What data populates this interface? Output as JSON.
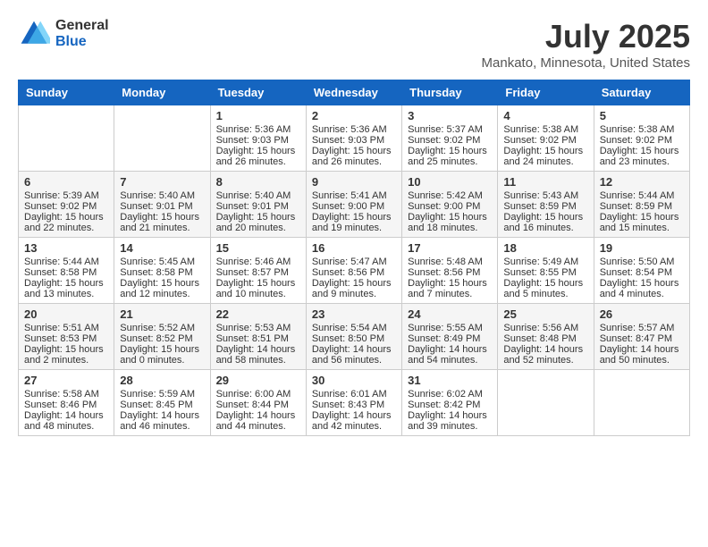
{
  "header": {
    "logo_general": "General",
    "logo_blue": "Blue",
    "month_title": "July 2025",
    "location": "Mankato, Minnesota, United States"
  },
  "calendar": {
    "days_of_week": [
      "Sunday",
      "Monday",
      "Tuesday",
      "Wednesday",
      "Thursday",
      "Friday",
      "Saturday"
    ],
    "weeks": [
      [
        {
          "day": "",
          "sunrise": "",
          "sunset": "",
          "daylight": ""
        },
        {
          "day": "",
          "sunrise": "",
          "sunset": "",
          "daylight": ""
        },
        {
          "day": "1",
          "sunrise": "Sunrise: 5:36 AM",
          "sunset": "Sunset: 9:03 PM",
          "daylight": "Daylight: 15 hours and 26 minutes."
        },
        {
          "day": "2",
          "sunrise": "Sunrise: 5:36 AM",
          "sunset": "Sunset: 9:03 PM",
          "daylight": "Daylight: 15 hours and 26 minutes."
        },
        {
          "day": "3",
          "sunrise": "Sunrise: 5:37 AM",
          "sunset": "Sunset: 9:02 PM",
          "daylight": "Daylight: 15 hours and 25 minutes."
        },
        {
          "day": "4",
          "sunrise": "Sunrise: 5:38 AM",
          "sunset": "Sunset: 9:02 PM",
          "daylight": "Daylight: 15 hours and 24 minutes."
        },
        {
          "day": "5",
          "sunrise": "Sunrise: 5:38 AM",
          "sunset": "Sunset: 9:02 PM",
          "daylight": "Daylight: 15 hours and 23 minutes."
        }
      ],
      [
        {
          "day": "6",
          "sunrise": "Sunrise: 5:39 AM",
          "sunset": "Sunset: 9:02 PM",
          "daylight": "Daylight: 15 hours and 22 minutes."
        },
        {
          "day": "7",
          "sunrise": "Sunrise: 5:40 AM",
          "sunset": "Sunset: 9:01 PM",
          "daylight": "Daylight: 15 hours and 21 minutes."
        },
        {
          "day": "8",
          "sunrise": "Sunrise: 5:40 AM",
          "sunset": "Sunset: 9:01 PM",
          "daylight": "Daylight: 15 hours and 20 minutes."
        },
        {
          "day": "9",
          "sunrise": "Sunrise: 5:41 AM",
          "sunset": "Sunset: 9:00 PM",
          "daylight": "Daylight: 15 hours and 19 minutes."
        },
        {
          "day": "10",
          "sunrise": "Sunrise: 5:42 AM",
          "sunset": "Sunset: 9:00 PM",
          "daylight": "Daylight: 15 hours and 18 minutes."
        },
        {
          "day": "11",
          "sunrise": "Sunrise: 5:43 AM",
          "sunset": "Sunset: 8:59 PM",
          "daylight": "Daylight: 15 hours and 16 minutes."
        },
        {
          "day": "12",
          "sunrise": "Sunrise: 5:44 AM",
          "sunset": "Sunset: 8:59 PM",
          "daylight": "Daylight: 15 hours and 15 minutes."
        }
      ],
      [
        {
          "day": "13",
          "sunrise": "Sunrise: 5:44 AM",
          "sunset": "Sunset: 8:58 PM",
          "daylight": "Daylight: 15 hours and 13 minutes."
        },
        {
          "day": "14",
          "sunrise": "Sunrise: 5:45 AM",
          "sunset": "Sunset: 8:58 PM",
          "daylight": "Daylight: 15 hours and 12 minutes."
        },
        {
          "day": "15",
          "sunrise": "Sunrise: 5:46 AM",
          "sunset": "Sunset: 8:57 PM",
          "daylight": "Daylight: 15 hours and 10 minutes."
        },
        {
          "day": "16",
          "sunrise": "Sunrise: 5:47 AM",
          "sunset": "Sunset: 8:56 PM",
          "daylight": "Daylight: 15 hours and 9 minutes."
        },
        {
          "day": "17",
          "sunrise": "Sunrise: 5:48 AM",
          "sunset": "Sunset: 8:56 PM",
          "daylight": "Daylight: 15 hours and 7 minutes."
        },
        {
          "day": "18",
          "sunrise": "Sunrise: 5:49 AM",
          "sunset": "Sunset: 8:55 PM",
          "daylight": "Daylight: 15 hours and 5 minutes."
        },
        {
          "day": "19",
          "sunrise": "Sunrise: 5:50 AM",
          "sunset": "Sunset: 8:54 PM",
          "daylight": "Daylight: 15 hours and 4 minutes."
        }
      ],
      [
        {
          "day": "20",
          "sunrise": "Sunrise: 5:51 AM",
          "sunset": "Sunset: 8:53 PM",
          "daylight": "Daylight: 15 hours and 2 minutes."
        },
        {
          "day": "21",
          "sunrise": "Sunrise: 5:52 AM",
          "sunset": "Sunset: 8:52 PM",
          "daylight": "Daylight: 15 hours and 0 minutes."
        },
        {
          "day": "22",
          "sunrise": "Sunrise: 5:53 AM",
          "sunset": "Sunset: 8:51 PM",
          "daylight": "Daylight: 14 hours and 58 minutes."
        },
        {
          "day": "23",
          "sunrise": "Sunrise: 5:54 AM",
          "sunset": "Sunset: 8:50 PM",
          "daylight": "Daylight: 14 hours and 56 minutes."
        },
        {
          "day": "24",
          "sunrise": "Sunrise: 5:55 AM",
          "sunset": "Sunset: 8:49 PM",
          "daylight": "Daylight: 14 hours and 54 minutes."
        },
        {
          "day": "25",
          "sunrise": "Sunrise: 5:56 AM",
          "sunset": "Sunset: 8:48 PM",
          "daylight": "Daylight: 14 hours and 52 minutes."
        },
        {
          "day": "26",
          "sunrise": "Sunrise: 5:57 AM",
          "sunset": "Sunset: 8:47 PM",
          "daylight": "Daylight: 14 hours and 50 minutes."
        }
      ],
      [
        {
          "day": "27",
          "sunrise": "Sunrise: 5:58 AM",
          "sunset": "Sunset: 8:46 PM",
          "daylight": "Daylight: 14 hours and 48 minutes."
        },
        {
          "day": "28",
          "sunrise": "Sunrise: 5:59 AM",
          "sunset": "Sunset: 8:45 PM",
          "daylight": "Daylight: 14 hours and 46 minutes."
        },
        {
          "day": "29",
          "sunrise": "Sunrise: 6:00 AM",
          "sunset": "Sunset: 8:44 PM",
          "daylight": "Daylight: 14 hours and 44 minutes."
        },
        {
          "day": "30",
          "sunrise": "Sunrise: 6:01 AM",
          "sunset": "Sunset: 8:43 PM",
          "daylight": "Daylight: 14 hours and 42 minutes."
        },
        {
          "day": "31",
          "sunrise": "Sunrise: 6:02 AM",
          "sunset": "Sunset: 8:42 PM",
          "daylight": "Daylight: 14 hours and 39 minutes."
        },
        {
          "day": "",
          "sunrise": "",
          "sunset": "",
          "daylight": ""
        },
        {
          "day": "",
          "sunrise": "",
          "sunset": "",
          "daylight": ""
        }
      ]
    ]
  }
}
